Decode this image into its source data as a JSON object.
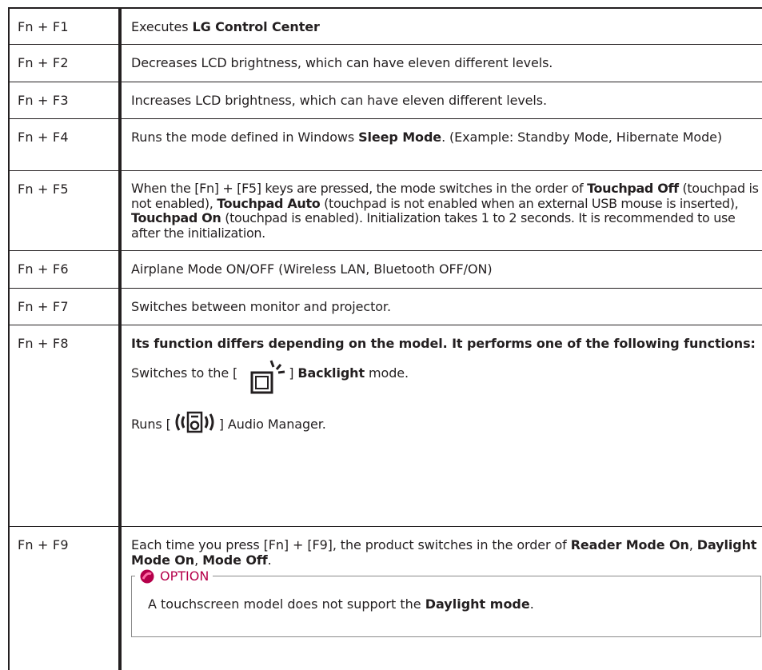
{
  "rows": [
    {
      "key": "Fn + F1",
      "parts": [
        "Executes ",
        "LG Control Center"
      ]
    },
    {
      "key": "Fn + F2",
      "text": "Decreases LCD brightness, which can have eleven different levels."
    },
    {
      "key": "Fn + F3",
      "text": "Increases LCD brightness, which can have eleven different levels."
    },
    {
      "key": "Fn + F4",
      "parts": [
        "Runs the mode defined in Windows ",
        "Sleep Mode",
        ". (Example: Standby Mode, Hibernate Mode)"
      ]
    },
    {
      "key": "Fn + F5",
      "parts": [
        "When the [Fn] + [F5] keys are pressed, the mode switches in the order of ",
        "Touchpad Off",
        " (touchpad is not enabled), ",
        "Touchpad Auto",
        " (touchpad is not enabled when an external USB mouse is inserted), ",
        "Touchpad On",
        " (touchpad is enabled). Initialization takes 1 to 2 seconds. It is recommended to use after the initialization."
      ]
    },
    {
      "key": "Fn + F6",
      "text": "Airplane Mode ON/OFF (Wireless LAN, Bluetooth OFF/ON)"
    },
    {
      "key": "Fn + F7",
      "text": "Switches between monitor and projector."
    },
    {
      "key": "Fn + F8",
      "heading": "Its function differs depending on the model. It performs one of the following functions:",
      "backlight": [
        "Switches to the [",
        "] ",
        "Backlight",
        " mode."
      ],
      "audio": [
        "Runs [",
        "] Audio Manager."
      ]
    },
    {
      "key": "Fn + F9",
      "parts": [
        "Each time you press [Fn] + [F9], the product switches in the order of ",
        "Reader Mode On",
        ", ",
        "Daylight Mode On",
        ", ",
        "Mode Off",
        "."
      ],
      "option": {
        "label": "OPTION",
        "parts": [
          "A touchscreen model does not support the ",
          "Daylight mode",
          "."
        ]
      }
    }
  ],
  "colors": {
    "option_accent": "#b5004a",
    "border": "#231f20",
    "option_border": "#8a8a8a"
  },
  "icons": {
    "backlight": "keyboard-backlight-icon",
    "audio": "audio-speaker-icon",
    "option": "option-badge-icon"
  }
}
